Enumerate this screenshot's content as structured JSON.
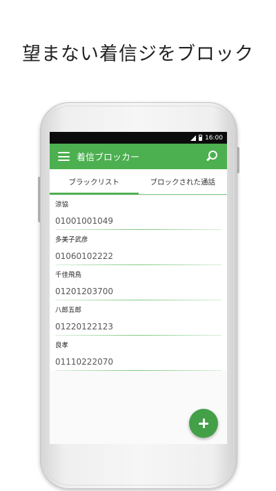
{
  "headline": "望まない着信ジをブロック",
  "statusbar": {
    "time": "16:00"
  },
  "appbar": {
    "title": "着信ブロッカー",
    "menu_icon": "menu-icon",
    "search_icon": "search-icon"
  },
  "tabs": [
    {
      "label": "ブラックリスト",
      "active": true
    },
    {
      "label": "ブロックされた通話",
      "active": false
    }
  ],
  "contacts": [
    {
      "name": "涼協",
      "number": "01001001049"
    },
    {
      "name": "多美子武彦",
      "number": "01060102222"
    },
    {
      "name": "千佳飛鳥",
      "number": "01201203700"
    },
    {
      "name": "八郎五郎",
      "number": "01220122123"
    },
    {
      "name": "良孝",
      "number": "01110222070"
    }
  ],
  "fab": {
    "icon": "plus-icon"
  },
  "colors": {
    "accent": "#4caf50",
    "statusbar": "#0b0b0b",
    "fab": "#43a047"
  }
}
